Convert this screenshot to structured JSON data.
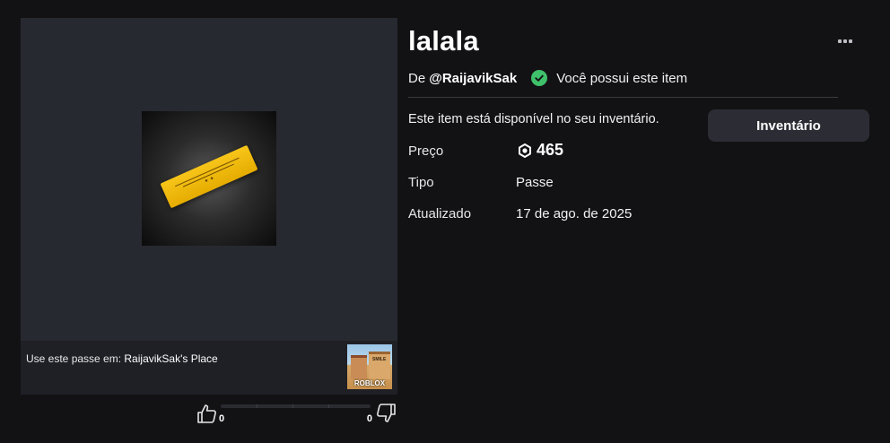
{
  "item": {
    "title": "lalala",
    "by_prefix": "De",
    "creator": "@RaijavikSak",
    "owned_status": "Você possui este item",
    "availability_text": "Este item está disponível no seu inventário.",
    "inventory_button": "Inventário"
  },
  "details": {
    "price_label": "Preço",
    "price_value": "465",
    "type_label": "Tipo",
    "type_value": "Passe",
    "updated_label": "Atualizado",
    "updated_value": "17 de ago. de 2025"
  },
  "place": {
    "use_prefix": "Use este passe em: ",
    "name": "RaijavikSak's Place",
    "thumb_sign": "SMILE",
    "thumb_logo": "ROBLOX"
  },
  "votes": {
    "up_count": "0",
    "down_count": "0"
  },
  "icons": {
    "owned": "check-circle-icon",
    "currency": "robux-icon",
    "menu": "more-options-icon",
    "like": "thumbs-up-icon",
    "dislike": "thumbs-down-icon"
  },
  "colors": {
    "background": "#121215",
    "panel": "#272930",
    "owned_check": "#3fc06b",
    "button": "#2c2d34",
    "ticket": "#f7c51a"
  }
}
